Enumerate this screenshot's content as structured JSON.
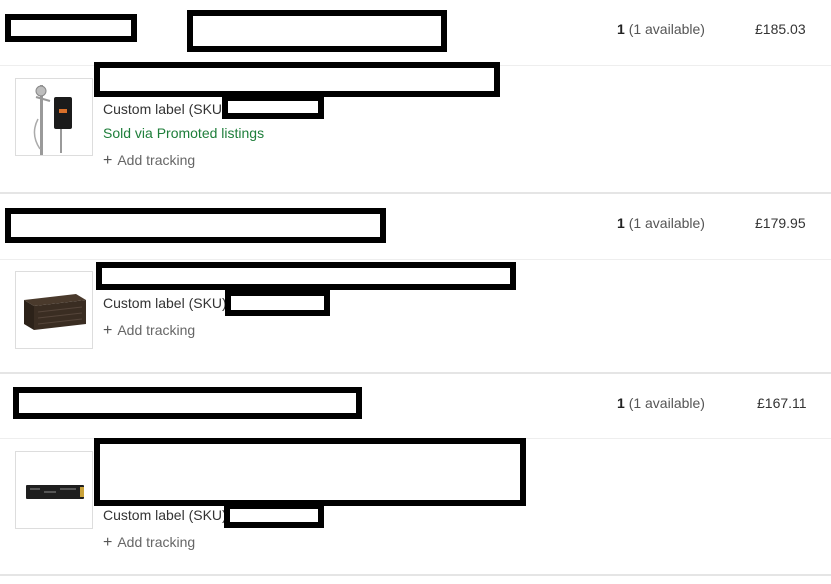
{
  "orders": [
    {
      "quantity": "1",
      "available": "(1 available)",
      "price": "£185.03",
      "item": {
        "image_icon": "electric-shower-icon",
        "sku_label": "Custom label (SKU):",
        "promo": "Sold via Promoted listings",
        "tracking_plus": "+",
        "tracking_label": "Add tracking"
      }
    },
    {
      "quantity": "1",
      "available": "(1 available)",
      "price": "£179.95",
      "item": {
        "image_icon": "storage-box-icon",
        "sku_label": "Custom label (SKU):",
        "tracking_plus": "+",
        "tracking_label": "Add tracking"
      }
    },
    {
      "quantity": "1",
      "available": "(1 available)",
      "price": "£167.11",
      "item": {
        "image_icon": "ssd-drive-icon",
        "sku_label": "Custom label (SKU):",
        "tracking_plus": "+",
        "tracking_label": "Add tracking"
      }
    }
  ],
  "colors": {
    "promo_green": "#1e7e3a",
    "redaction": "#000000",
    "divider": "#e5e5e5"
  }
}
